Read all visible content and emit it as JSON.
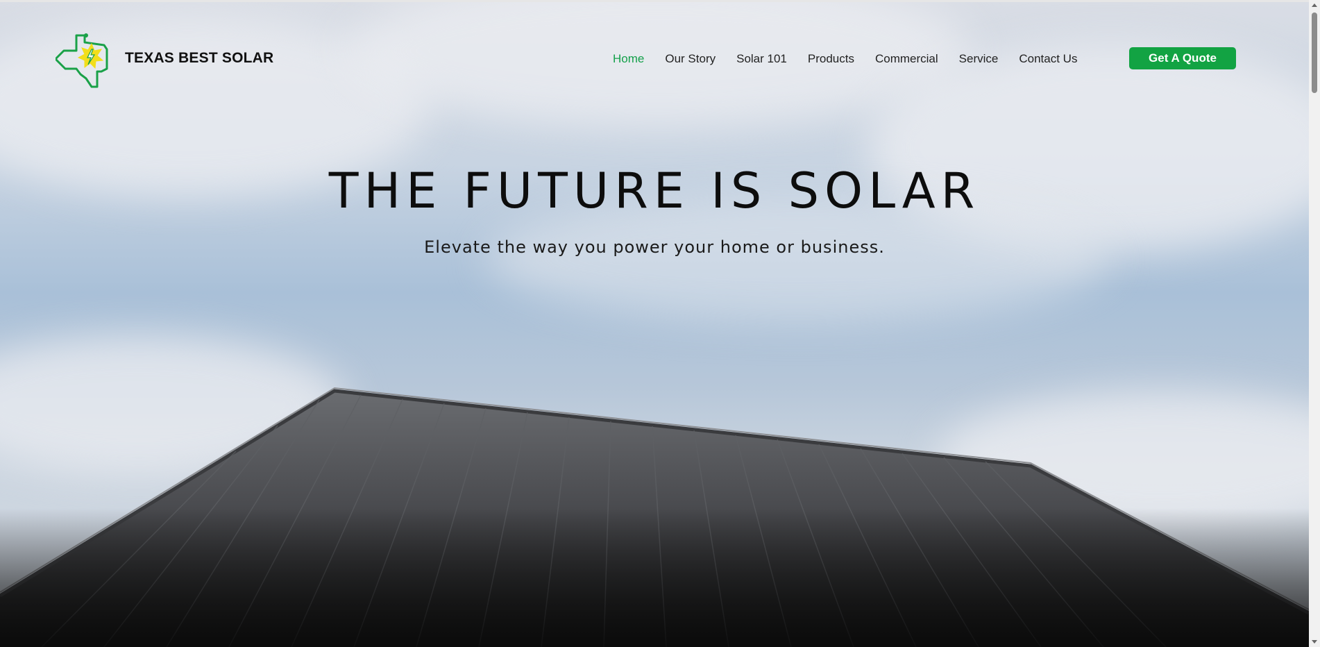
{
  "brand": {
    "name": "TEXAS BEST SOLAR",
    "logo_icon": "texas-sun-bolt-logo",
    "accent_color": "#12a343"
  },
  "nav": {
    "items": [
      {
        "label": "Home",
        "active": true
      },
      {
        "label": "Our Story",
        "active": false
      },
      {
        "label": "Solar 101",
        "active": false
      },
      {
        "label": "Products",
        "active": false
      },
      {
        "label": "Commercial",
        "active": false
      },
      {
        "label": "Service",
        "active": false
      },
      {
        "label": "Contact Us",
        "active": false
      }
    ],
    "active_color": "#14a04a"
  },
  "cta": {
    "label": "Get A Quote"
  },
  "hero": {
    "headline": "THE FUTURE IS SOLAR",
    "subheadline": "Elevate the way you power your home or business."
  }
}
